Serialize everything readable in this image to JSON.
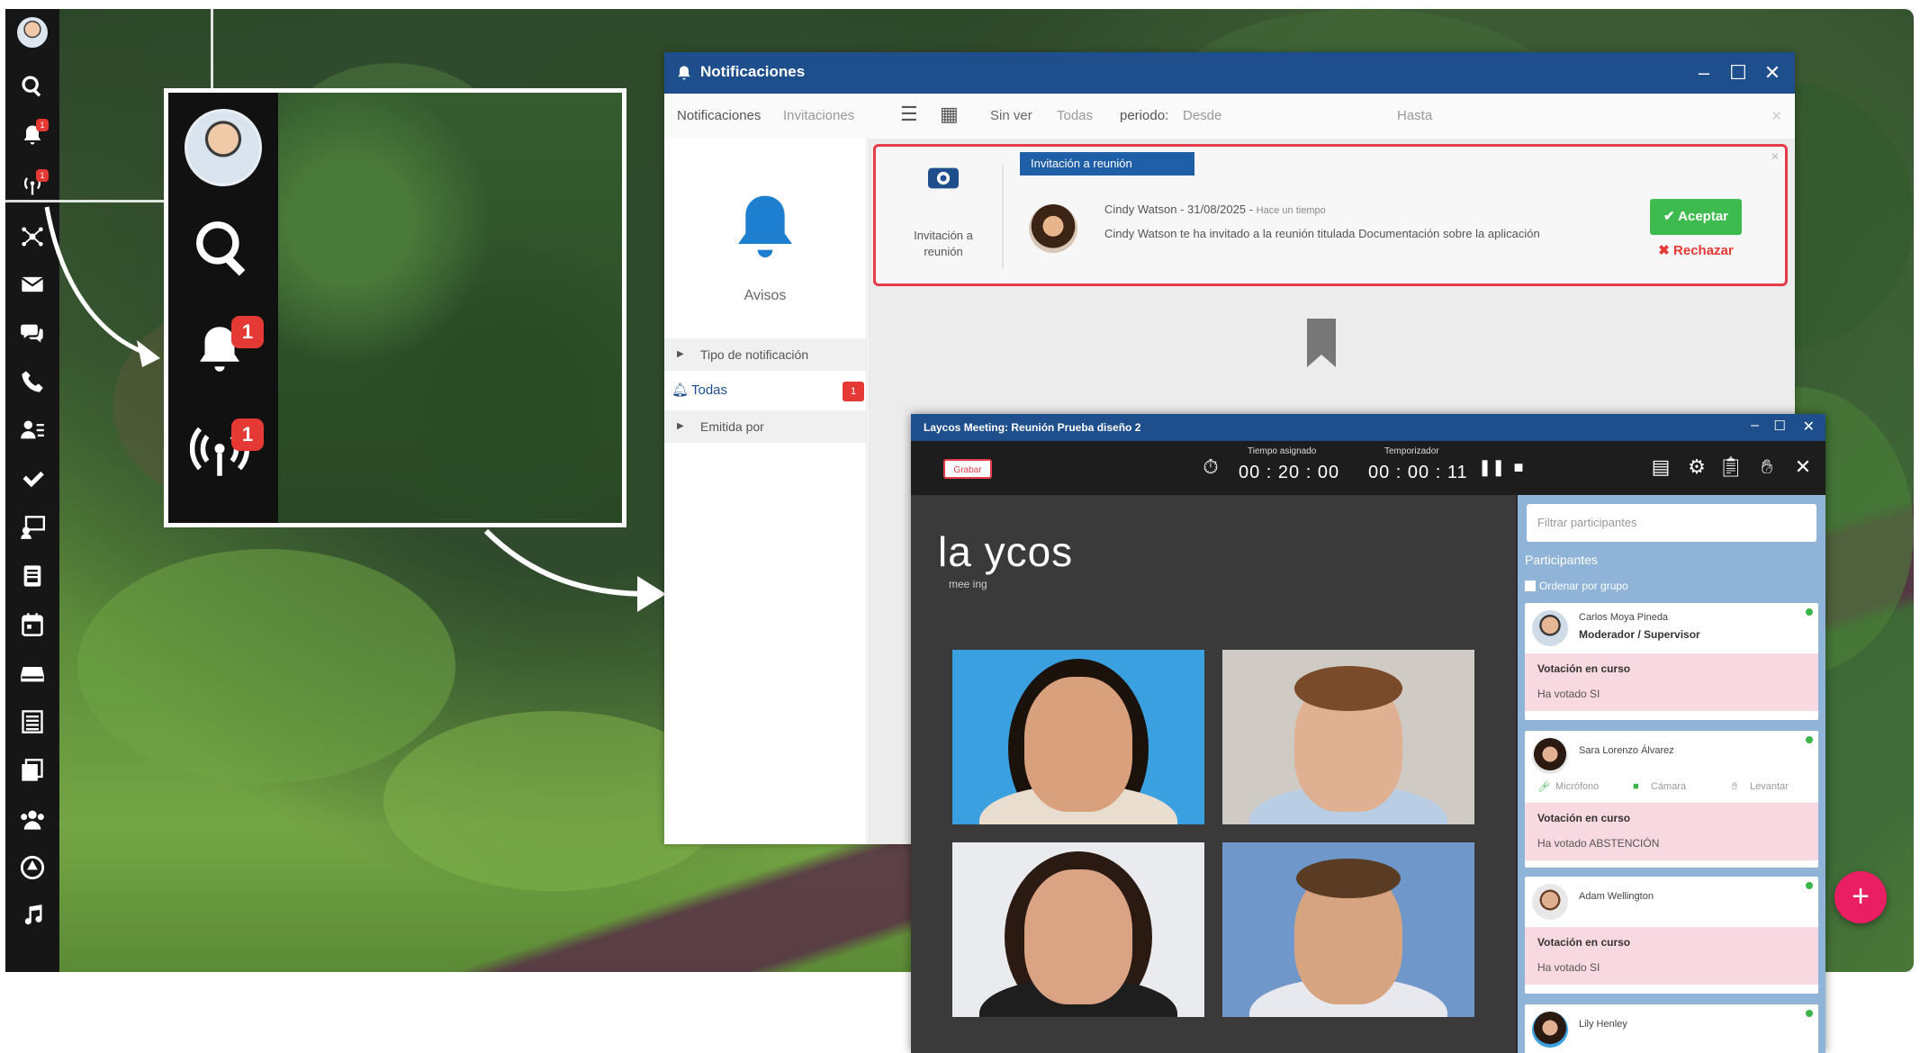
{
  "taskbar": {
    "badge_count": "1",
    "icons": [
      "avatar",
      "search-icon",
      "bell-icon",
      "broadcast-icon",
      "network-icon",
      "mail-icon",
      "chat-icon",
      "phone-icon",
      "users-list-icon",
      "check-icon",
      "projector-icon",
      "address-book-icon",
      "calendar-icon",
      "inbox-icon",
      "list-icon",
      "document-stack-icon",
      "group-icon",
      "drive-icon",
      "music-icon"
    ]
  },
  "zoom": {
    "bell_badge": "1",
    "broadcast_badge": "1"
  },
  "notifications": {
    "title": "Notificaciones",
    "tabs": [
      "Notificaciones",
      "Invitaciones"
    ],
    "filters": {
      "status": "Sin ver",
      "all": "Todas",
      "period_label": "periodo:",
      "from": "Desde",
      "to": "Hasta"
    },
    "sidebar": {
      "heading": "Avisos",
      "group_type": "Tipo de notificación",
      "all_item": "Todas",
      "all_badge": "1",
      "group_emitted": "Emitida por"
    },
    "card": {
      "tag": "Invitación a reunión",
      "type_label": "Invitación a reunión",
      "sender": "Cindy Watson",
      "date": "31/08/2025",
      "status_note": "Hace un tiempo",
      "message": "Cindy Watson te ha invitado a la reunión titulada Documentación sobre la aplicación",
      "accept": "Aceptar",
      "reject": "Rechazar"
    }
  },
  "meeting": {
    "title": "Laycos Meeting: Reunión Prueba diseño 2",
    "record_label": "Grabar",
    "assigned_label": "Tiempo asignado",
    "assigned_value": "00 : 20 : 00",
    "timer_label": "Temporizador",
    "timer_value": "00 : 00 : 11",
    "logo_main": "la ycos",
    "logo_sub": "mee ing",
    "panel": {
      "filter_placeholder": "Filtrar participantes",
      "section": "Participantes",
      "group_toggle": "Ordenar por grupo",
      "participants": [
        {
          "name": "Carlos Moya Pineda",
          "role": "Moderador / Supervisor",
          "vote_title": "Votación en curso",
          "vote_value": "Ha votado SI"
        },
        {
          "name": "Sara Lorenzo Álvarez",
          "mic": "Micrófono",
          "cam": "Cámara",
          "hand": "Levantar",
          "vote_title": "Votación en curso",
          "vote_value": "Ha votado ABSTENCIÓN"
        },
        {
          "name": "Adam Wellington",
          "vote_title": "Votación en curso",
          "vote_value": "Ha votado SI"
        },
        {
          "name": "Lily Henley"
        }
      ]
    }
  },
  "fab_label": "+"
}
